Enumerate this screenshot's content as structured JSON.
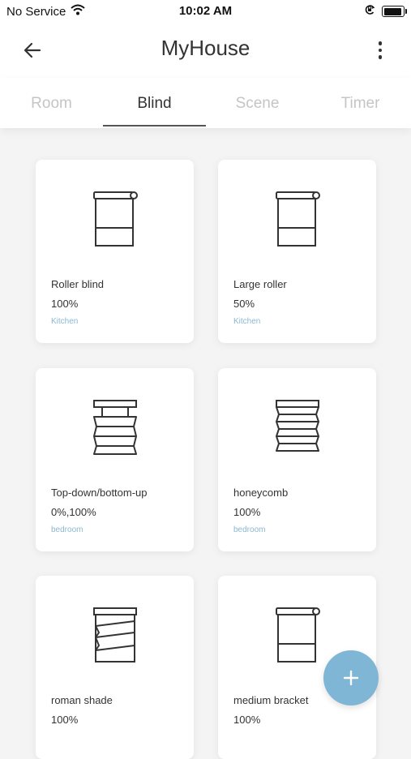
{
  "status_bar": {
    "carrier": "No Service",
    "time": "10:02 AM"
  },
  "header": {
    "title": "MyHouse"
  },
  "tabs": [
    {
      "label": "Room"
    },
    {
      "label": "Blind"
    },
    {
      "label": "Scene"
    },
    {
      "label": "Timer"
    }
  ],
  "active_tab": "Blind",
  "devices": [
    {
      "name": "Roller blind",
      "value": "100%",
      "room": "Kitchen",
      "icon": "roller-blind-icon"
    },
    {
      "name": "Large roller",
      "value": "50%",
      "room": "Kitchen",
      "icon": "roller-blind-icon"
    },
    {
      "name": "Top-down/bottom-up",
      "value": "0%,100%",
      "room": "bedroom",
      "icon": "top-down-bottom-up-icon"
    },
    {
      "name": "honeycomb",
      "value": "100%",
      "room": "bedroom",
      "icon": "honeycomb-icon"
    },
    {
      "name": "roman shade",
      "value": "100%",
      "room": "",
      "icon": "roman-shade-icon"
    },
    {
      "name": "medium bracket",
      "value": "100%",
      "room": "",
      "icon": "roller-blind-icon"
    }
  ],
  "colors": {
    "accent": "#7fb6d5",
    "room_text": "#8ab8d0",
    "inactive_tab": "#c5c5c5"
  }
}
